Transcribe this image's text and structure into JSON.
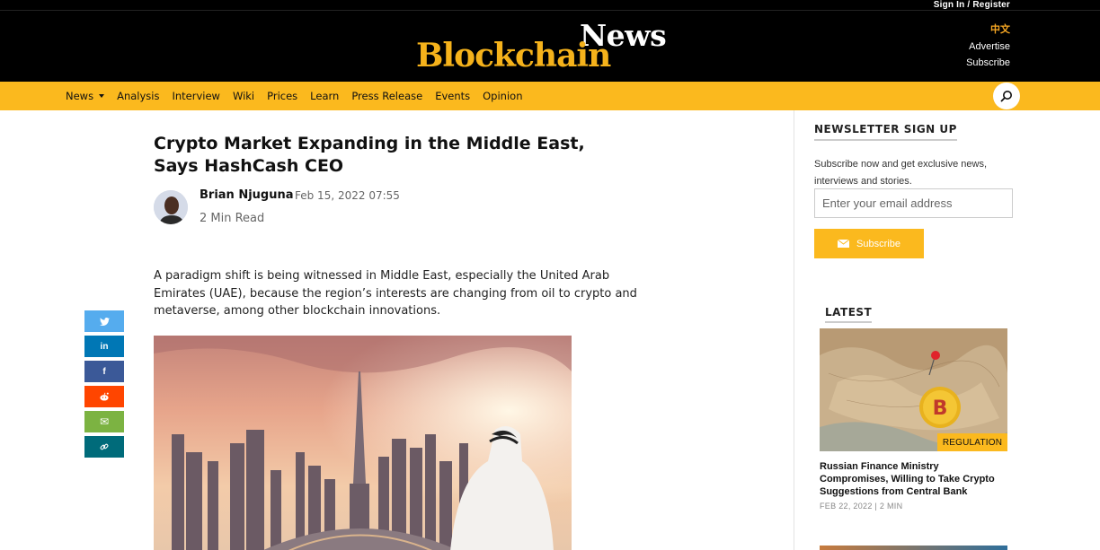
{
  "header": {
    "signin_label": "Sign In / Register",
    "logo_news": "News",
    "logo_blockchain": "Blockchain",
    "lang_label": "中文",
    "advertise_label": "Advertise",
    "subscribe_label": "Subscribe"
  },
  "nav": {
    "items": [
      "News",
      "Analysis",
      "Interview",
      "Wiki",
      "Prices",
      "Learn",
      "Press Release",
      "Events",
      "Opinion"
    ],
    "search_icon": "search-icon"
  },
  "article": {
    "title": "Crypto Market Expanding in the Middle East, Says HashCash CEO",
    "author": "Brian Njuguna",
    "date": "Feb 15, 2022 07:55",
    "read_time": "2 Min Read",
    "lead": "A paradigm shift is being witnessed in Middle East, especially the United Arab Emirates (UAE), because the region’s interests are changing from oil to crypto and metaverse, among other blockchain innovations."
  },
  "share": {
    "icons": [
      "twitter-icon",
      "linkedin-icon",
      "facebook-icon",
      "reddit-icon",
      "email-icon",
      "link-icon"
    ],
    "colors": [
      "#55acee",
      "#0077b5",
      "#3b5998",
      "#ff4500",
      "#7cb342",
      "#006b7a"
    ],
    "twitter_glyph": "t",
    "linkedin_glyph": "in",
    "facebook_glyph": "f",
    "reddit_glyph": "●",
    "email_glyph": "✉",
    "link_glyph": "🔗"
  },
  "sidebar": {
    "newsletter_title": "NEWSLETTER SIGN UP",
    "newsletter_text": "Subscribe now and get exclusive news, interviews and stories.",
    "email_placeholder": "Enter your email address",
    "subscribe_button": "Subscribe",
    "latest_title": "LATEST",
    "latest": {
      "badge": "REGULATION",
      "headline": "Russian Finance Ministry Compromises, Willing to Take Crypto Suggestions from Central Bank",
      "meta": "FEB 22, 2022 | 2 MIN"
    }
  },
  "colors": {
    "accent": "#fbb91e",
    "header_bg": "#000000",
    "logo_gold": "#f5b21b"
  }
}
